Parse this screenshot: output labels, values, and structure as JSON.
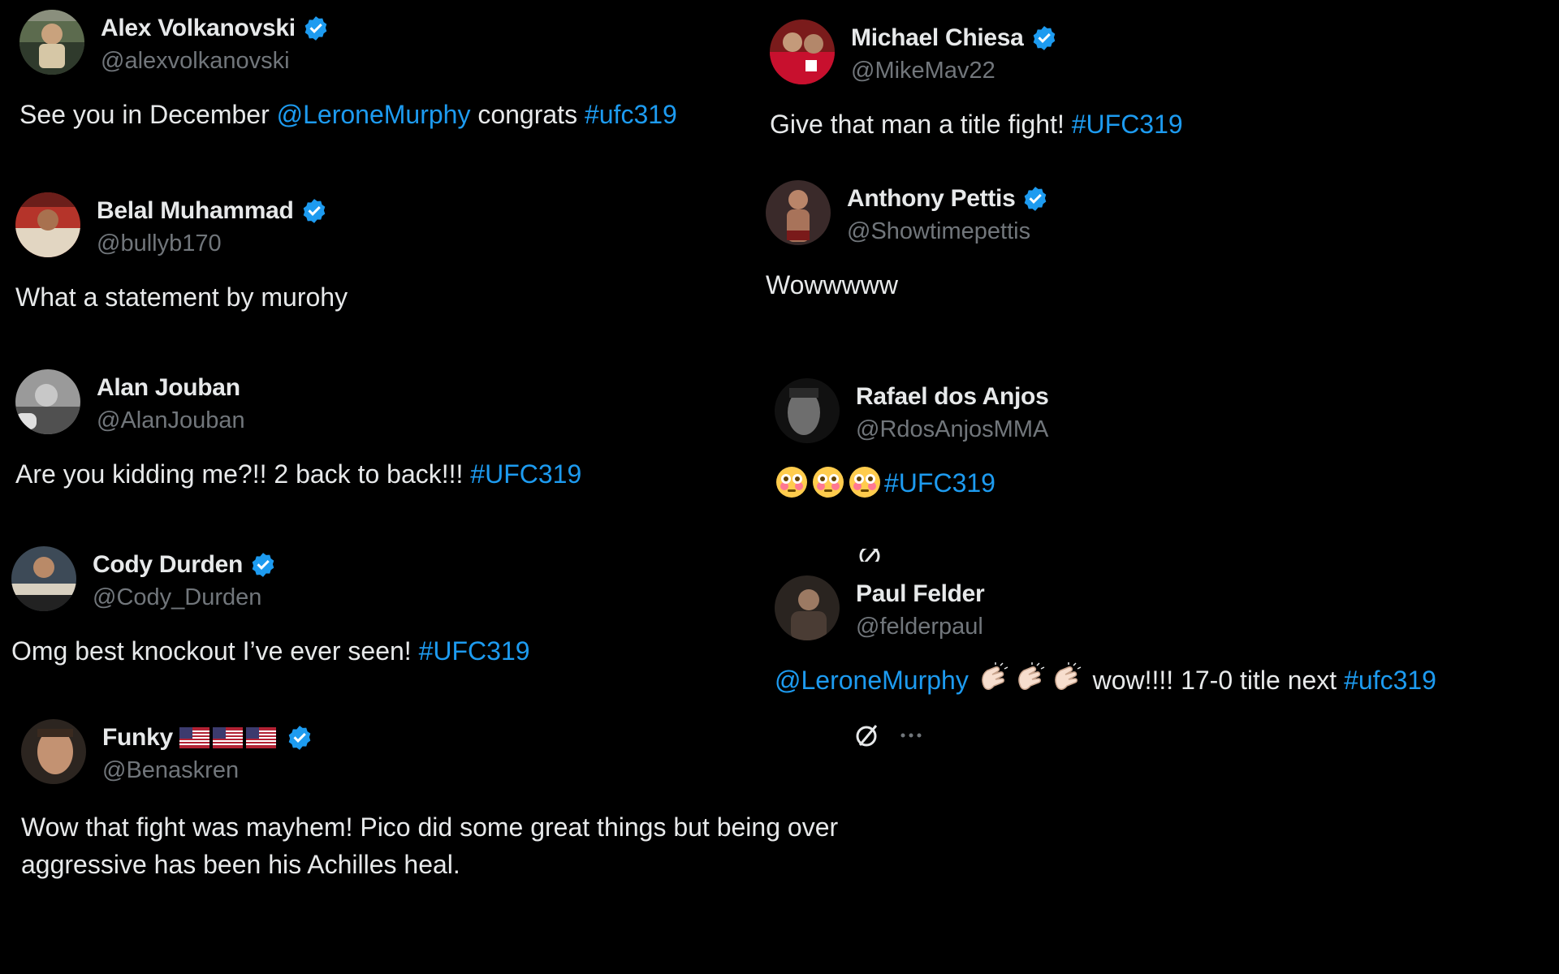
{
  "colors": {
    "background": "#000000",
    "text": "#e7e9ea",
    "handle": "#71767b",
    "link": "#1d9bf0",
    "verified": "#1d9bf0"
  },
  "tweets": [
    {
      "name": "Alex Volkanovski",
      "handle": "@alexvolkanovski",
      "verified": true,
      "segments": [
        {
          "text": "See you in December ",
          "link": false
        },
        {
          "text": "@LeroneMurphy",
          "link": true
        },
        {
          "text": " congrats ",
          "link": false
        },
        {
          "text": "#ufc319",
          "link": true
        }
      ]
    },
    {
      "name": "Belal Muhammad",
      "handle": "@bullyb170",
      "verified": true,
      "segments": [
        {
          "text": "What a statement  by murohy",
          "link": false
        }
      ]
    },
    {
      "name": "Alan Jouban",
      "handle": "@AlanJouban",
      "verified": false,
      "segments": [
        {
          "text": "Are you kidding me?!! 2 back to back!!! ",
          "link": false
        },
        {
          "text": "#UFC319",
          "link": true
        }
      ]
    },
    {
      "name": "Cody Durden",
      "handle": "@Cody_Durden",
      "verified": true,
      "segments": [
        {
          "text": "Omg best knockout I’ve ever seen! ",
          "link": false
        },
        {
          "text": "#UFC319",
          "link": true
        }
      ]
    },
    {
      "name": "Funky",
      "handle": "@Benaskren",
      "verified": true,
      "flag_icons": [
        "us-flag-icon",
        "us-flag-icon",
        "us-flag-icon"
      ],
      "segments": [
        {
          "text": "Wow that fight was mayhem!  Pico did some great things but being over aggressive has been his Achilles heal.",
          "link": false
        }
      ]
    },
    {
      "name": "Michael Chiesa",
      "handle": "@MikeMav22",
      "verified": true,
      "segments": [
        {
          "text": "Give that man a title fight! ",
          "link": false
        },
        {
          "text": "#UFC319",
          "link": true
        }
      ]
    },
    {
      "name": "Anthony Pettis",
      "handle": "@Showtimepettis",
      "verified": true,
      "segments": [
        {
          "text": "Wowwwww",
          "link": false
        }
      ]
    },
    {
      "name": "Rafael dos Anjos",
      "handle": "@RdosAnjosMMA",
      "verified": false,
      "emojis": [
        "flushed-face-icon",
        "flushed-face-icon",
        "flushed-face-icon"
      ],
      "segments": [
        {
          "text": "#UFC319",
          "link": true
        }
      ]
    },
    {
      "name": "Paul Felder",
      "handle": "@felderpaul",
      "verified": false,
      "segments": [
        {
          "text": "@LeroneMurphy",
          "link": true
        },
        {
          "text": " wow!!!! 17-0 title next ",
          "link": false
        },
        {
          "text": "#ufc319",
          "link": true
        }
      ],
      "emojis": [
        "clapping-hands-icon",
        "clapping-hands-icon",
        "clapping-hands-icon"
      ]
    }
  ],
  "action_icons": [
    "grok-icon",
    "more-options-icon"
  ]
}
